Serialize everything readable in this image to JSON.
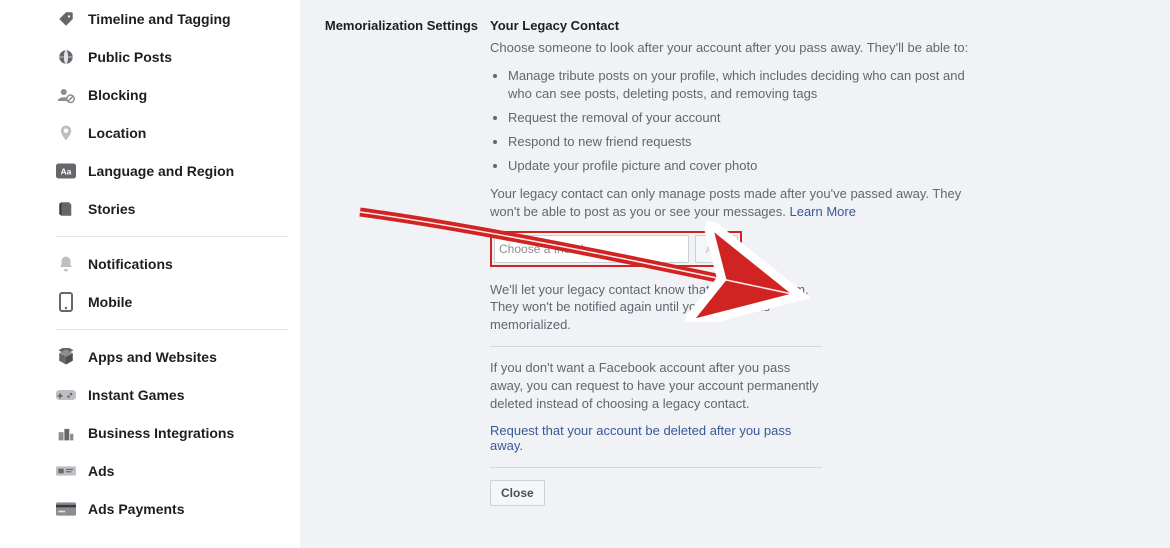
{
  "sidebar": {
    "items": [
      {
        "label": "Timeline and Tagging",
        "icon": "tag-icon"
      },
      {
        "label": "Public Posts",
        "icon": "globe-icon"
      },
      {
        "label": "Blocking",
        "icon": "block-user-icon"
      },
      {
        "label": "Location",
        "icon": "location-pin-icon"
      },
      {
        "label": "Language and Region",
        "icon": "language-icon"
      },
      {
        "label": "Stories",
        "icon": "stories-icon"
      }
    ],
    "items2": [
      {
        "label": "Notifications",
        "icon": "bell-icon"
      },
      {
        "label": "Mobile",
        "icon": "mobile-icon"
      }
    ],
    "items3": [
      {
        "label": "Apps and Websites",
        "icon": "apps-icon"
      },
      {
        "label": "Instant Games",
        "icon": "games-icon"
      },
      {
        "label": "Business Integrations",
        "icon": "business-icon"
      },
      {
        "label": "Ads",
        "icon": "ads-icon"
      },
      {
        "label": "Ads Payments",
        "icon": "card-icon"
      }
    ]
  },
  "settings": {
    "section_label": "Memorialization Settings",
    "title": "Your Legacy Contact",
    "intro": "Choose someone to look after your account after you pass away. They'll be able to:",
    "bullets": [
      "Manage tribute posts on your profile, which includes deciding who can post and who can see posts, deleting posts, and removing tags",
      "Request the removal of your account",
      "Respond to new friend requests",
      "Update your profile picture and cover photo"
    ],
    "post_bullets": "Your legacy contact can only manage posts made after you've passed away. They won't be able to post as you or see your messages. ",
    "learn_more": "Learn More",
    "input_placeholder": "Choose a friend",
    "add_btn": "Add",
    "after_add": "We'll let your legacy contact know that you chose them. They won't be notified again until your account is memorialized.",
    "delete_text": "If you don't want a Facebook account after you pass away, you can request to have your account permanently deleted instead of choosing a legacy contact.",
    "delete_link": "Request that your account be deleted after you pass away.",
    "close_btn": "Close"
  },
  "colors": {
    "link": "#385898",
    "highlight_border": "#d22323",
    "muted_text": "#606770"
  }
}
